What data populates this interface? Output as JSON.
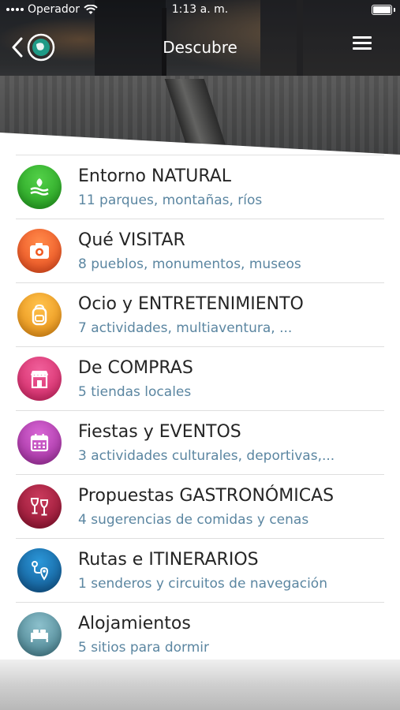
{
  "status_bar": {
    "carrier": "Operador",
    "time": "1:13 a. m."
  },
  "nav": {
    "title": "Descubre"
  },
  "categories": [
    {
      "title": "Entorno NATURAL",
      "subtitle": "11 parques, montañas, ríos",
      "icon": "nature-icon",
      "color": "#2ea62a"
    },
    {
      "title": "Qué VISITAR",
      "subtitle": "8 pueblos, monumentos, museos",
      "icon": "camera-icon",
      "color": "#f0581f"
    },
    {
      "title": "Ocio y ENTRETENIMIENTO",
      "subtitle": "7 actividades, multiaventura, ...",
      "icon": "backpack-icon",
      "color": "#f2a01c"
    },
    {
      "title": "De COMPRAS",
      "subtitle": "5 tiendas locales",
      "icon": "shop-icon",
      "color": "#e2357a"
    },
    {
      "title": "Fiestas y EVENTOS",
      "subtitle": "3 actividades culturales, deportivas,...",
      "icon": "calendar-icon",
      "color": "#b63db4"
    },
    {
      "title": "Propuestas GASTRONÓMICAS",
      "subtitle": "4 sugerencias de comidas y cenas",
      "icon": "wine-glasses-icon",
      "color": "#a5183a"
    },
    {
      "title": "Rutas e ITINERARIOS",
      "subtitle": "1 senderos y circuitos de navegación",
      "icon": "route-icon",
      "color": "#1f7fc4"
    },
    {
      "title": "Alojamientos",
      "subtitle": "5 sitios para dormir",
      "icon": "bed-icon",
      "color": "#5e9aa9"
    }
  ]
}
